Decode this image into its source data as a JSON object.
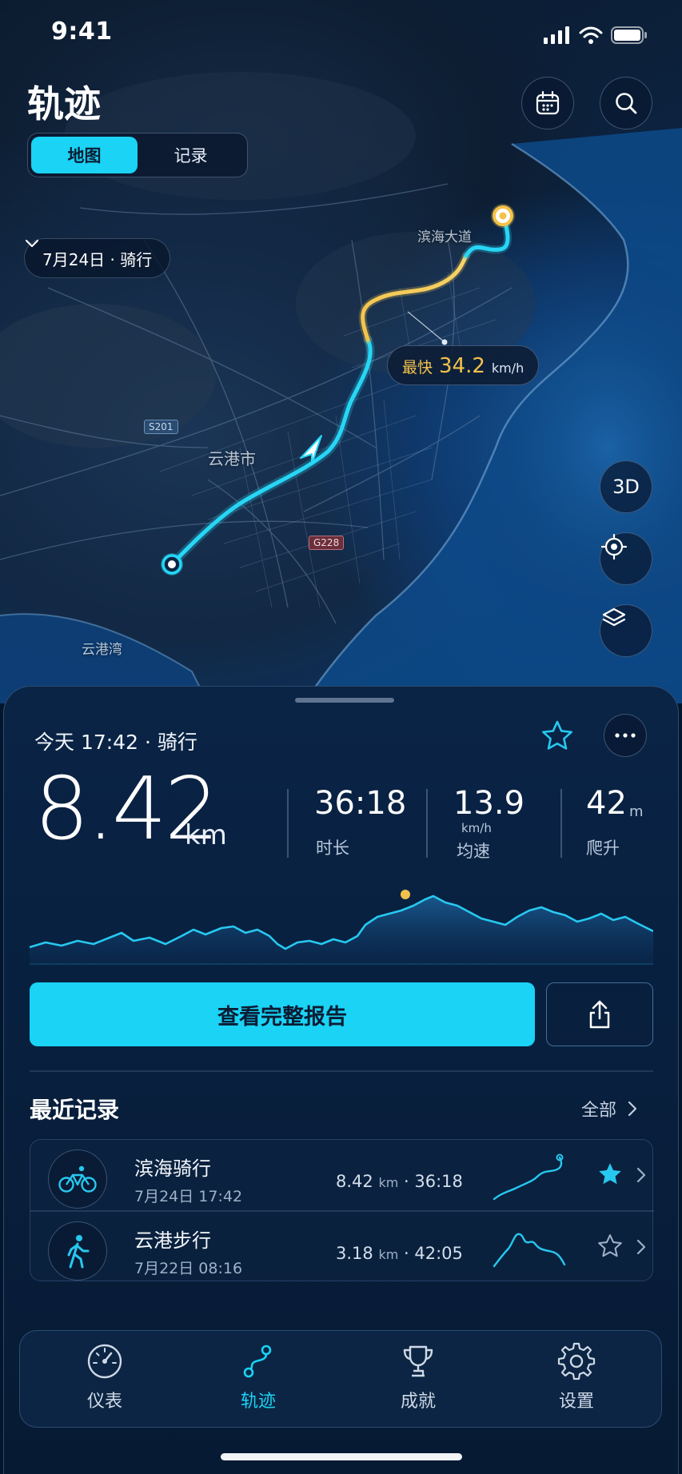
{
  "status_bar": {
    "time": "9:41"
  },
  "header": {
    "title": "轨迹",
    "view_toggle": [
      "地图",
      "记录"
    ],
    "active_view": "地图",
    "calendar_icon": "calendar-icon",
    "search_icon": "search-icon"
  },
  "map": {
    "date_filter": "7月24日 · 骑行",
    "labels": {
      "road": "滨海大道",
      "city": "云港市",
      "bay": "云港湾",
      "shield_1": "S201",
      "shield_2": "G228"
    },
    "fastest": {
      "label": "最快",
      "value": "34.2",
      "unit": "km/h"
    },
    "controls": {
      "view_3d": "3D",
      "locate_icon": "crosshair-icon",
      "layers_icon": "layers-icon"
    },
    "colors": {
      "route": "#27d6f5",
      "route_fast": "#f3c24a"
    }
  },
  "activity": {
    "header": "今天  17:42 · 骑行",
    "star_icon": "star-outline-icon",
    "more_icon": "more-icon",
    "distance": "8.42",
    "distance_unit": "km",
    "stats": [
      {
        "value": "36:18",
        "label": "时长"
      },
      {
        "value": "13.9",
        "unit": "km/h",
        "label": "均速"
      },
      {
        "value": "42",
        "unit": "m",
        "label": "爬升"
      }
    ],
    "primary_button": "查看完整报告",
    "share_icon": "share-icon"
  },
  "recent": {
    "title": "最近记录",
    "see_all": "全部",
    "items": [
      {
        "icon": "bike-icon",
        "name": "滨海骑行",
        "date": "7月24日  17:42",
        "distance": "8.42",
        "distance_unit": "km",
        "duration": "36:18",
        "starred": true
      },
      {
        "icon": "walk-icon",
        "name": "云港步行",
        "date": "7月22日  08:16",
        "distance": "3.18",
        "distance_unit": "km",
        "duration": "42:05",
        "starred": false
      }
    ]
  },
  "tabbar": {
    "active": "轨迹",
    "tabs": [
      {
        "label": "仪表",
        "icon": "gauge-icon"
      },
      {
        "label": "轨迹",
        "icon": "route-icon"
      },
      {
        "label": "成就",
        "icon": "trophy-icon"
      },
      {
        "label": "设置",
        "icon": "gear-icon"
      }
    ]
  }
}
